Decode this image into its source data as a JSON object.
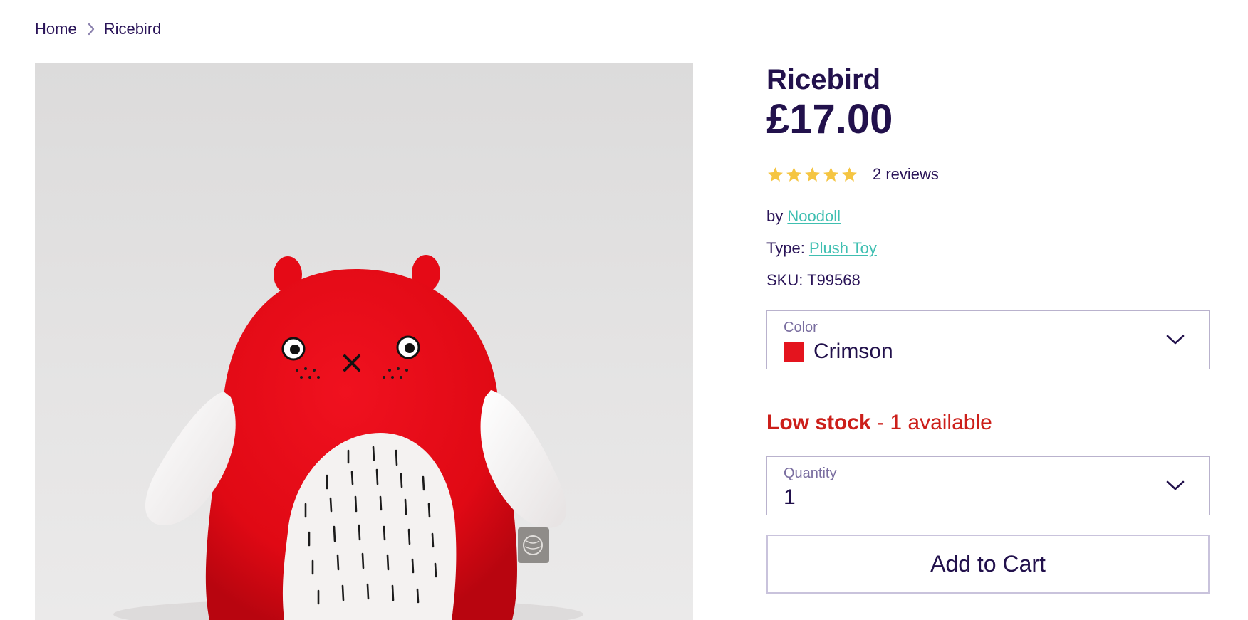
{
  "breadcrumb": {
    "home": "Home",
    "current": "Ricebird"
  },
  "product": {
    "title": "Ricebird",
    "price": "£17.00",
    "rating": 5,
    "reviews": "2 reviews",
    "vendor_prefix": "by",
    "vendor": "Noodoll",
    "type_label": "Type:",
    "type": "Plush Toy",
    "sku_label": "SKU:",
    "sku": "T99568",
    "image_alt": "Ricebird red plush toy"
  },
  "color_select": {
    "label": "Color",
    "value": "Crimson",
    "swatch": "#e4141e"
  },
  "stock": {
    "status": "Low stock",
    "detail": " - 1 available"
  },
  "quantity_select": {
    "label": "Quantity",
    "value": "1"
  },
  "cart": {
    "button_label": "Add to Cart"
  },
  "colors": {
    "primary_text": "#22114c",
    "link": "#3fbfb1",
    "stock_warning": "#cc1f1a",
    "star": "#f5c542"
  },
  "icons": {
    "breadcrumb_separator": "chevron-right-icon",
    "select_arrow": "chevron-down-icon",
    "rating": "star-icon"
  }
}
